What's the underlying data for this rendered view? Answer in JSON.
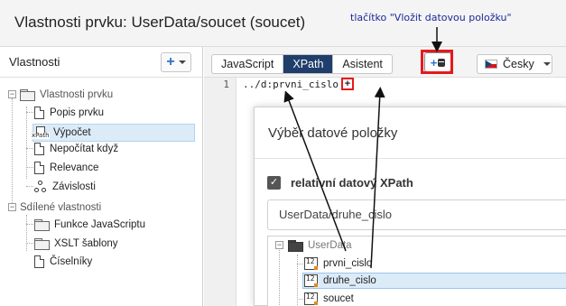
{
  "window": {
    "title": "Vlastnosti prvku: UserData/soucet (soucet)"
  },
  "annotation": {
    "insert_button_callout": "tlačítko \"Vložit datovou položku\""
  },
  "left_panel": {
    "title": "Vlastnosti",
    "add_button": {
      "icon": "plus-icon"
    },
    "tree": {
      "group1": {
        "label": "Vlastnosti prvku",
        "items": [
          "Popis prvku",
          "Výpočet",
          "Nepočítat když",
          "Relevance",
          "Závislosti"
        ]
      },
      "group2": {
        "label": "Sdílené vlastnosti",
        "items": [
          "Funkce JavaScriptu",
          "XSLT šablony",
          "Číselníky"
        ]
      },
      "xpath_icon_text": "xPath"
    }
  },
  "toolbar": {
    "tabs": [
      "JavaScript",
      "XPath",
      "Asistent"
    ],
    "active_tab": "XPath",
    "language": "Česky"
  },
  "editor": {
    "line_number": "1",
    "code": "../d:prvni_cislo",
    "inline_insert": "+"
  },
  "dialog": {
    "title": "Výběr datové položky",
    "checkbox_label": "relativní datový XPath",
    "checkbox_checked": true,
    "path_value": "UserData/druhe_cislo",
    "tree": {
      "root": "UserData",
      "items": [
        "prvni_cislo",
        "druhe_cislo",
        "soucet"
      ],
      "selected": "druhe_cislo",
      "type_badge": "12"
    }
  },
  "colors": {
    "accent_tab": "#1f3e6b",
    "highlight_red": "#e41b1b",
    "annotation_blue": "#1a2a9a",
    "selection": "#dcebf8"
  }
}
